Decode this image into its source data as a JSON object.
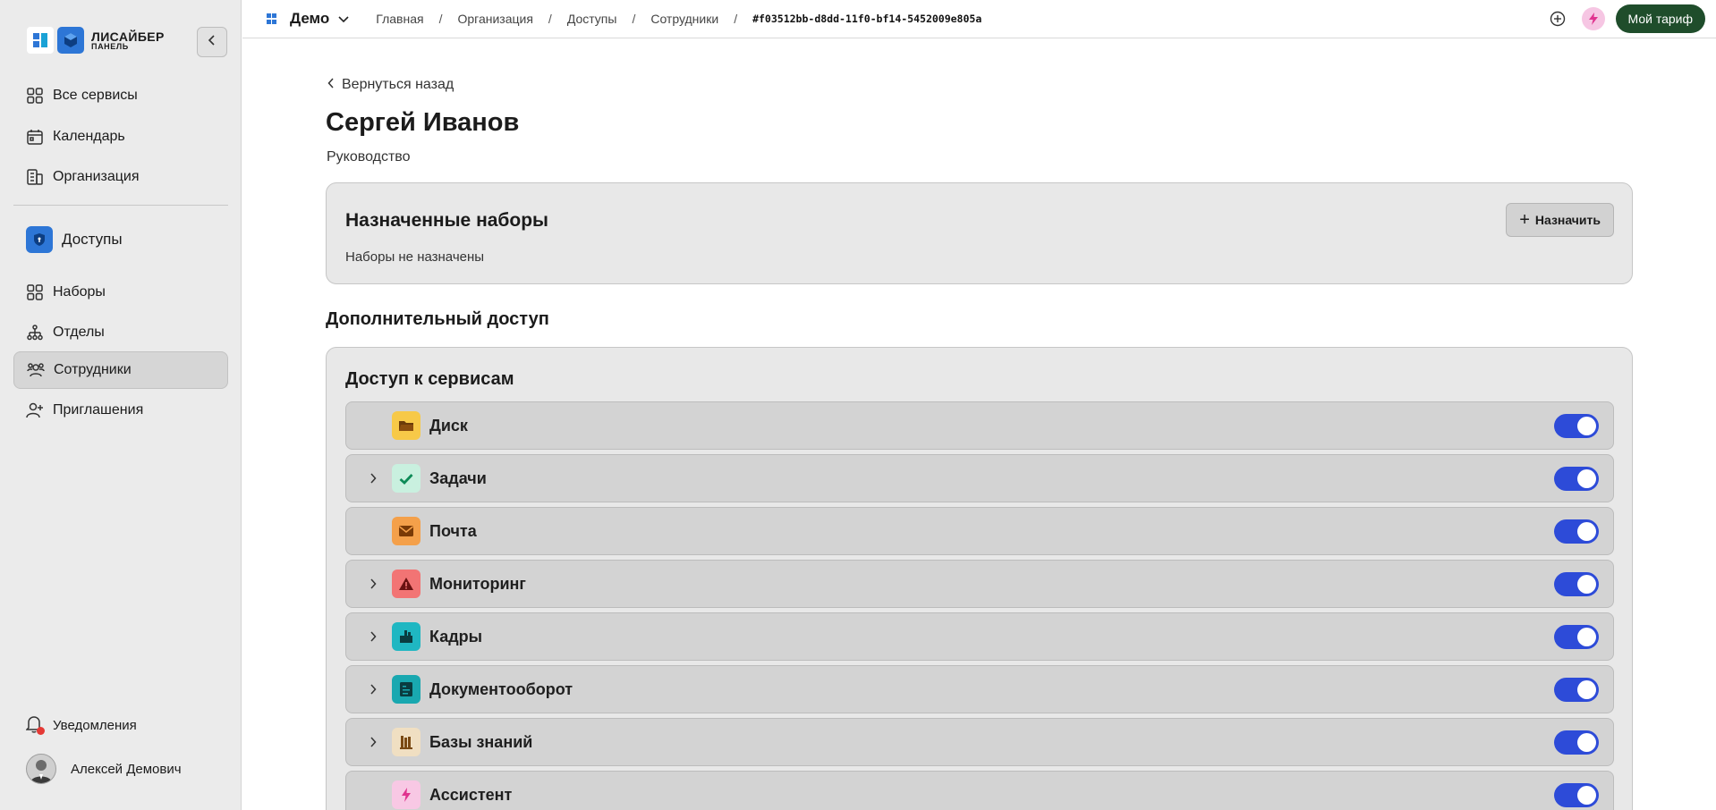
{
  "brand": {
    "name": "ЛИСАЙБЕР",
    "sub": "ПАНЕЛЬ"
  },
  "sidebar": {
    "top_items": [
      {
        "label": "Все сервисы",
        "icon": "grid-icon"
      },
      {
        "label": "Календарь",
        "icon": "calendar-icon"
      },
      {
        "label": "Организация",
        "icon": "building-icon"
      }
    ],
    "section": {
      "label": "Доступы",
      "icon": "shield-icon"
    },
    "section_items": [
      {
        "label": "Наборы",
        "icon": "grid-icon",
        "active": false
      },
      {
        "label": "Отделы",
        "icon": "org-chart-icon",
        "active": false
      },
      {
        "label": "Сотрудники",
        "icon": "users-icon",
        "active": true
      },
      {
        "label": "Приглашения",
        "icon": "user-plus-icon",
        "active": false
      }
    ],
    "notifications_label": "Уведомления",
    "user_name": "Алексей Демович"
  },
  "topbar": {
    "org_name": "Демо",
    "breadcrumbs": [
      "Главная",
      "Организация",
      "Доступы",
      "Сотрудники"
    ],
    "current_id": "#f03512bb-d8dd-11f0-bf14-5452009e805a",
    "plan_label": "Мой тариф"
  },
  "page": {
    "back_label": "Вернуться назад",
    "title": "Сергей Иванов",
    "subtitle": "Руководство",
    "assigned_sets": {
      "title": "Назначенные наборы",
      "empty_text": "Наборы не назначены",
      "assign_label": "Назначить"
    },
    "extra_access_title": "Дополнительный доступ",
    "services_title": "Доступ к сервисам",
    "services": [
      {
        "name": "Диск",
        "icon": "folder-icon",
        "color": "#f7c948",
        "expandable": false,
        "enabled": true
      },
      {
        "name": "Задачи",
        "icon": "check-icon",
        "color": "#c9f0df",
        "expandable": true,
        "enabled": true
      },
      {
        "name": "Почта",
        "icon": "mail-icon",
        "color": "#f4a04a",
        "expandable": false,
        "enabled": true
      },
      {
        "name": "Мониторинг",
        "icon": "warning-icon",
        "color": "#f27474",
        "expandable": true,
        "enabled": true
      },
      {
        "name": "Кадры",
        "icon": "personnel-icon",
        "color": "#1fb7c2",
        "expandable": true,
        "enabled": true
      },
      {
        "name": "Документооборот",
        "icon": "document-icon",
        "color": "#19a8b0",
        "expandable": true,
        "enabled": true
      },
      {
        "name": "Базы знаний",
        "icon": "books-icon",
        "color": "#f0dfc2",
        "expandable": true,
        "enabled": true
      },
      {
        "name": "Ассистент",
        "icon": "bolt-icon",
        "color": "#f8c8e4",
        "expandable": false,
        "enabled": true
      }
    ]
  },
  "colors": {
    "toggle_on": "#2d4bd8",
    "plan_button": "#1f4d2b",
    "brand_blue": "#2d76d6"
  }
}
